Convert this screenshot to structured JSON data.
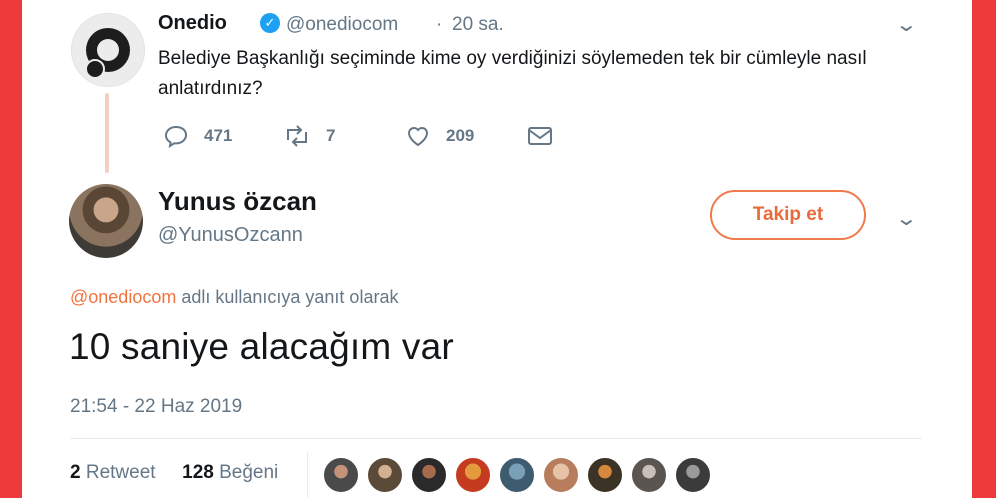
{
  "parent_tweet": {
    "name": "Onedio",
    "handle": "@onediocom",
    "separator": "·",
    "time": "20 sa.",
    "text": "Belediye Başkanlığı seçiminde kime oy verdiğinizi söylemeden tek bir cümleyle nasıl anlatırdınız?",
    "reply_icon": "reply-icon",
    "reply_count": "471",
    "retweet_icon": "retweet-icon",
    "retweet_count": "7",
    "like_icon": "heart-icon",
    "like_count": "209",
    "dm_icon": "envelope-icon"
  },
  "reply_tweet": {
    "name": "Yunus özcan",
    "handle": "@YunusOzcann",
    "follow_label": "Takip et",
    "reply_to_mention": "@onediocom",
    "reply_to_suffix": " adlı kullanıcıya yanıt olarak",
    "text": "10 saniye alacağım var",
    "timestamp": "21:54 - 22 Haz 2019",
    "retweets_count": "2",
    "retweets_label": "Retweet",
    "likes_count": "128",
    "likes_label": "Beğeni"
  },
  "colors": {
    "background": "#ef3a3b",
    "accent": "#f0733f",
    "verified": "#1da1f2",
    "muted": "#657786"
  }
}
